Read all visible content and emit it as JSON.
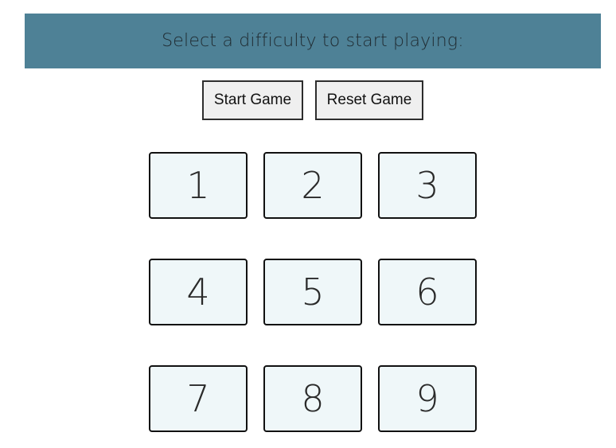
{
  "banner": {
    "text": "Select a difficulty to start playing:",
    "background": "#4e8196"
  },
  "controls": {
    "start_label": "Start Game",
    "reset_label": "Reset Game"
  },
  "tiles": [
    "1",
    "2",
    "3",
    "4",
    "5",
    "6",
    "7",
    "8",
    "9"
  ],
  "colors": {
    "tile_background": "#eff7f9",
    "tile_border": "#111111",
    "button_background": "#efefef"
  }
}
